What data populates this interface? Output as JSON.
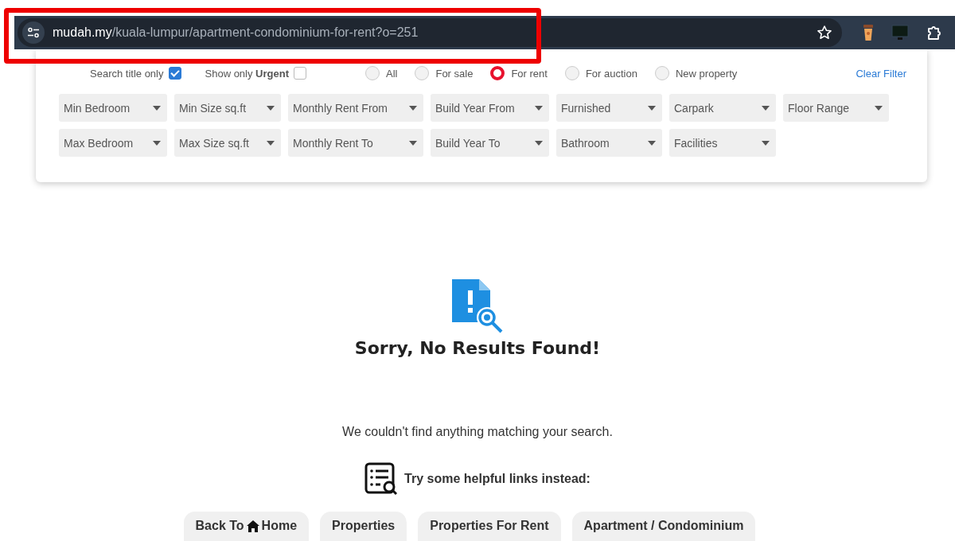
{
  "browser": {
    "url_host": "mudah.my",
    "url_path": "/kuala-lumpur/apartment-condominium-for-rent?o=251"
  },
  "filters": {
    "options": [
      {
        "label": "Search title only",
        "checked": true
      },
      {
        "label": "Show only **Urgent**",
        "checked": false
      }
    ],
    "types": [
      {
        "label": "All",
        "selected": false
      },
      {
        "label": "For sale",
        "selected": false
      },
      {
        "label": "For rent",
        "selected": true
      },
      {
        "label": "For auction",
        "selected": false
      },
      {
        "label": "New property",
        "selected": false
      }
    ],
    "clear_filter": "Clear Filter",
    "dropdown_rows": [
      [
        "Min Bedroom",
        "Min Size sq.ft",
        "Monthly Rent From",
        "Build Year From",
        "Furnished",
        "Carpark",
        "Floor Range"
      ],
      [
        "Max Bedroom",
        "Max Size sq.ft",
        "Monthly Rent To",
        "Build Year To",
        "Bathroom",
        "Facilities"
      ]
    ]
  },
  "empty_state": {
    "title": "Sorry, No Results Found!",
    "message": "We couldn't find anything matching your search.",
    "links_heading": "Try some helpful links instead:",
    "links": [
      {
        "prefix": "Back To",
        "kind": "home",
        "label": "Home"
      },
      {
        "label": "Properties"
      },
      {
        "label": "Properties For Rent"
      },
      {
        "label": "Apartment / Condominium"
      }
    ]
  }
}
